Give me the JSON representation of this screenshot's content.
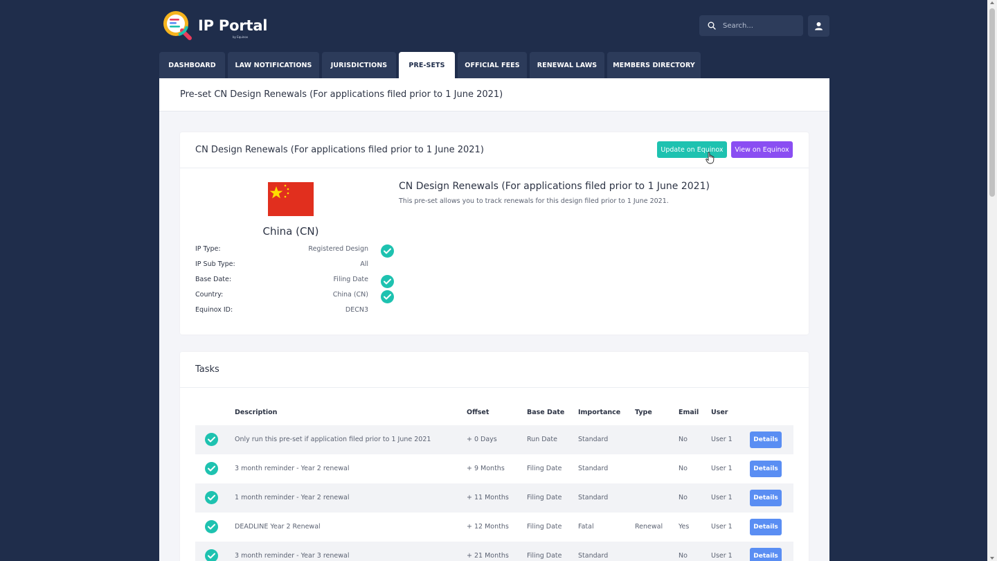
{
  "app": {
    "title": "IP Portal",
    "subtitle": "by Equinox"
  },
  "search": {
    "placeholder": "Search..."
  },
  "tabs": [
    {
      "label": "DASHBOARD"
    },
    {
      "label": "LAW NOTIFICATIONS"
    },
    {
      "label": "JURISDICTIONS"
    },
    {
      "label": "PRE-SETS",
      "active": true
    },
    {
      "label": "OFFICIAL FEES"
    },
    {
      "label": "RENEWAL LAWS"
    },
    {
      "label": "MEMBERS DIRECTORY"
    }
  ],
  "page": {
    "title": "Pre-set CN Design Renewals (For applications filed prior to 1 June 2021)"
  },
  "preset_card": {
    "title": "CN Design Renewals (For applications filed prior to 1 June 2021)",
    "update_button": "Update on Equinox",
    "view_button": "View on Equinox",
    "country": "China (CN)",
    "details": [
      {
        "label": "IP Type:",
        "value": "Registered Design",
        "checked": true
      },
      {
        "label": "IP Sub Type:",
        "value": "All",
        "checked": false
      },
      {
        "label": "Base Date:",
        "value": "Filing Date",
        "checked": true
      },
      {
        "label": "Country:",
        "value": "China (CN)",
        "checked": true
      },
      {
        "label": "Equinox ID:",
        "value": "DECN3",
        "checked": false
      }
    ],
    "heading": "CN Design Renewals (For applications filed prior to 1 June 2021)",
    "description": "This pre-set allows you to track renewals for this design filed prior to 1 June 2021."
  },
  "tasks": {
    "title": "Tasks",
    "columns": [
      "Description",
      "Offset",
      "Base Date",
      "Importance",
      "Type",
      "Email",
      "User"
    ],
    "details_label": "Details",
    "rows": [
      {
        "description": "Only run this pre-set if application filed prior to 1 June 2021",
        "offset": "+ 0 Days",
        "base_date": "Run Date",
        "importance": "Standard",
        "type": "",
        "email": "No",
        "user": "User 1"
      },
      {
        "description": "3 month reminder - Year 2 renewal",
        "offset": "+ 9 Months",
        "base_date": "Filing Date",
        "importance": "Standard",
        "type": "",
        "email": "No",
        "user": "User 1"
      },
      {
        "description": "1 month reminder - Year 2 renewal",
        "offset": "+ 11 Months",
        "base_date": "Filing Date",
        "importance": "Standard",
        "type": "",
        "email": "No",
        "user": "User 1"
      },
      {
        "description": "DEADLINE Year 2 Renewal",
        "offset": "+ 12 Months",
        "base_date": "Filing Date",
        "importance": "Fatal",
        "type": "Renewal",
        "email": "Yes",
        "user": "User 1"
      },
      {
        "description": "3 month reminder - Year 3 renewal",
        "offset": "+ 21 Months",
        "base_date": "Filing Date",
        "importance": "Standard",
        "type": "",
        "email": "No",
        "user": "User 1"
      }
    ]
  },
  "colors": {
    "background": "#1f2d4b",
    "teal": "#1ec2b0",
    "purple": "#8a4ef2",
    "details": "#5a8ef3",
    "flag_red": "#e12f1e",
    "flag_star": "#ffde00"
  }
}
